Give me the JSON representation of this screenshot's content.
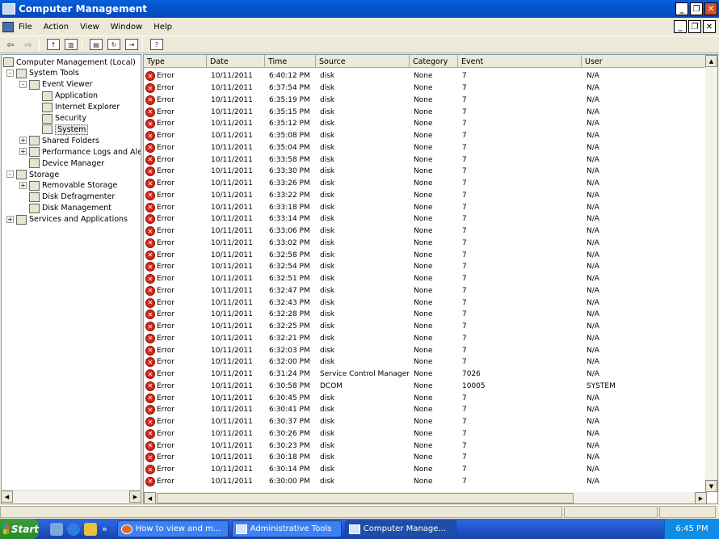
{
  "window": {
    "title": "Computer Management"
  },
  "menu": [
    "File",
    "Action",
    "View",
    "Window",
    "Help"
  ],
  "tree": [
    {
      "label": "Computer Management (Local)",
      "level": 0
    },
    {
      "label": "System Tools",
      "level": 1,
      "exp": "-"
    },
    {
      "label": "Event Viewer",
      "level": 2,
      "exp": "-"
    },
    {
      "label": "Application",
      "level": 3
    },
    {
      "label": "Internet Explorer",
      "level": 3
    },
    {
      "label": "Security",
      "level": 3
    },
    {
      "label": "System",
      "level": 3,
      "selected": true
    },
    {
      "label": "Shared Folders",
      "level": 2,
      "exp": "+"
    },
    {
      "label": "Performance Logs and Alerts",
      "level": 2,
      "exp": "+"
    },
    {
      "label": "Device Manager",
      "level": 2
    },
    {
      "label": "Storage",
      "level": 1,
      "exp": "-"
    },
    {
      "label": "Removable Storage",
      "level": 2,
      "exp": "+"
    },
    {
      "label": "Disk Defragmenter",
      "level": 2
    },
    {
      "label": "Disk Management",
      "level": 2
    },
    {
      "label": "Services and Applications",
      "level": 1,
      "exp": "+"
    }
  ],
  "columns": [
    "Type",
    "Date",
    "Time",
    "Source",
    "Category",
    "Event",
    "User"
  ],
  "events": [
    [
      "Error",
      "10/11/2011",
      "6:40:12 PM",
      "disk",
      "None",
      "7",
      "N/A"
    ],
    [
      "Error",
      "10/11/2011",
      "6:37:54 PM",
      "disk",
      "None",
      "7",
      "N/A"
    ],
    [
      "Error",
      "10/11/2011",
      "6:35:19 PM",
      "disk",
      "None",
      "7",
      "N/A"
    ],
    [
      "Error",
      "10/11/2011",
      "6:35:15 PM",
      "disk",
      "None",
      "7",
      "N/A"
    ],
    [
      "Error",
      "10/11/2011",
      "6:35:12 PM",
      "disk",
      "None",
      "7",
      "N/A"
    ],
    [
      "Error",
      "10/11/2011",
      "6:35:08 PM",
      "disk",
      "None",
      "7",
      "N/A"
    ],
    [
      "Error",
      "10/11/2011",
      "6:35:04 PM",
      "disk",
      "None",
      "7",
      "N/A"
    ],
    [
      "Error",
      "10/11/2011",
      "6:33:58 PM",
      "disk",
      "None",
      "7",
      "N/A"
    ],
    [
      "Error",
      "10/11/2011",
      "6:33:30 PM",
      "disk",
      "None",
      "7",
      "N/A"
    ],
    [
      "Error",
      "10/11/2011",
      "6:33:26 PM",
      "disk",
      "None",
      "7",
      "N/A"
    ],
    [
      "Error",
      "10/11/2011",
      "6:33:22 PM",
      "disk",
      "None",
      "7",
      "N/A"
    ],
    [
      "Error",
      "10/11/2011",
      "6:33:18 PM",
      "disk",
      "None",
      "7",
      "N/A"
    ],
    [
      "Error",
      "10/11/2011",
      "6:33:14 PM",
      "disk",
      "None",
      "7",
      "N/A"
    ],
    [
      "Error",
      "10/11/2011",
      "6:33:06 PM",
      "disk",
      "None",
      "7",
      "N/A"
    ],
    [
      "Error",
      "10/11/2011",
      "6:33:02 PM",
      "disk",
      "None",
      "7",
      "N/A"
    ],
    [
      "Error",
      "10/11/2011",
      "6:32:58 PM",
      "disk",
      "None",
      "7",
      "N/A"
    ],
    [
      "Error",
      "10/11/2011",
      "6:32:54 PM",
      "disk",
      "None",
      "7",
      "N/A"
    ],
    [
      "Error",
      "10/11/2011",
      "6:32:51 PM",
      "disk",
      "None",
      "7",
      "N/A"
    ],
    [
      "Error",
      "10/11/2011",
      "6:32:47 PM",
      "disk",
      "None",
      "7",
      "N/A"
    ],
    [
      "Error",
      "10/11/2011",
      "6:32:43 PM",
      "disk",
      "None",
      "7",
      "N/A"
    ],
    [
      "Error",
      "10/11/2011",
      "6:32:28 PM",
      "disk",
      "None",
      "7",
      "N/A"
    ],
    [
      "Error",
      "10/11/2011",
      "6:32:25 PM",
      "disk",
      "None",
      "7",
      "N/A"
    ],
    [
      "Error",
      "10/11/2011",
      "6:32:21 PM",
      "disk",
      "None",
      "7",
      "N/A"
    ],
    [
      "Error",
      "10/11/2011",
      "6:32:03 PM",
      "disk",
      "None",
      "7",
      "N/A"
    ],
    [
      "Error",
      "10/11/2011",
      "6:32:00 PM",
      "disk",
      "None",
      "7",
      "N/A"
    ],
    [
      "Error",
      "10/11/2011",
      "6:31:24 PM",
      "Service Control Manager",
      "None",
      "7026",
      "N/A"
    ],
    [
      "Error",
      "10/11/2011",
      "6:30:58 PM",
      "DCOM",
      "None",
      "10005",
      "SYSTEM"
    ],
    [
      "Error",
      "10/11/2011",
      "6:30:45 PM",
      "disk",
      "None",
      "7",
      "N/A"
    ],
    [
      "Error",
      "10/11/2011",
      "6:30:41 PM",
      "disk",
      "None",
      "7",
      "N/A"
    ],
    [
      "Error",
      "10/11/2011",
      "6:30:37 PM",
      "disk",
      "None",
      "7",
      "N/A"
    ],
    [
      "Error",
      "10/11/2011",
      "6:30:26 PM",
      "disk",
      "None",
      "7",
      "N/A"
    ],
    [
      "Error",
      "10/11/2011",
      "6:30:23 PM",
      "disk",
      "None",
      "7",
      "N/A"
    ],
    [
      "Error",
      "10/11/2011",
      "6:30:18 PM",
      "disk",
      "None",
      "7",
      "N/A"
    ],
    [
      "Error",
      "10/11/2011",
      "6:30:14 PM",
      "disk",
      "None",
      "7",
      "N/A"
    ],
    [
      "Error",
      "10/11/2011",
      "6:30:00 PM",
      "disk",
      "None",
      "7",
      "N/A"
    ]
  ],
  "taskbar": {
    "start": "Start",
    "tasks": [
      "How to view and m...",
      "Administrative Tools",
      "Computer Manage..."
    ],
    "clock": "6:45 PM"
  }
}
